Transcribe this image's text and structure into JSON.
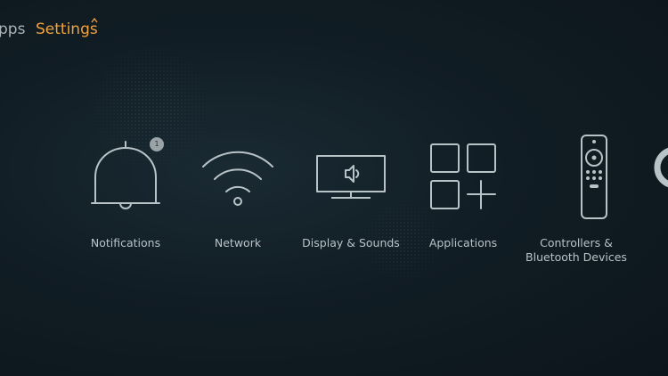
{
  "nav": {
    "apps_label": "pps",
    "settings_label": "Settings"
  },
  "tiles": [
    {
      "label": "Notifications",
      "icon": "bell-icon",
      "badge": "1"
    },
    {
      "label": "Network",
      "icon": "wifi-icon"
    },
    {
      "label": "Display & Sounds",
      "icon": "tv-speaker-icon"
    },
    {
      "label": "Applications",
      "icon": "apps-grid-icon"
    },
    {
      "label": "Controllers & Bluetooth Devices",
      "icon": "remote-control-icon"
    }
  ],
  "colors": {
    "accent": "#f0a23c",
    "icon_stroke": "#b8c3c8",
    "background": "#111d24"
  }
}
